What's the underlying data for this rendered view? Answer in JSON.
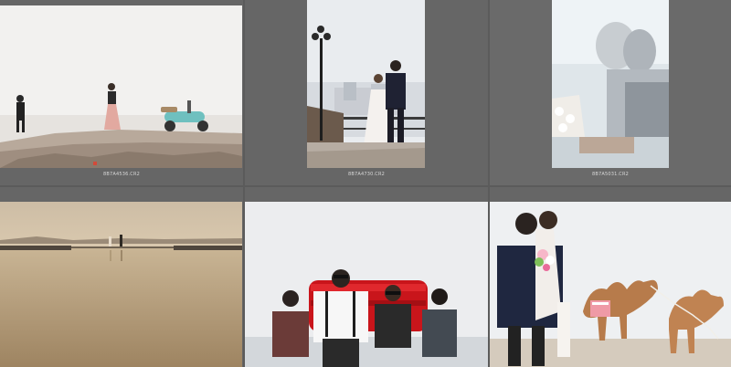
{
  "grid": {
    "cells": [
      {
        "filename": "8B7A4536.CR2",
        "scene": "cliff-couple-scooter"
      },
      {
        "filename": "8B7A4730.CR2",
        "scene": "couple-lamp-post"
      },
      {
        "filename": "8B7A5031.CR2",
        "scene": "couple-kiss-soft"
      },
      {
        "filename": "",
        "scene": "sepia-lake"
      },
      {
        "filename": "",
        "scene": "group-red-sofa"
      },
      {
        "filename": "",
        "scene": "couple-camels"
      }
    ]
  },
  "colors": {
    "background": "#5b5b5b",
    "cell": "#666666",
    "caption": "#d8d8d8"
  }
}
